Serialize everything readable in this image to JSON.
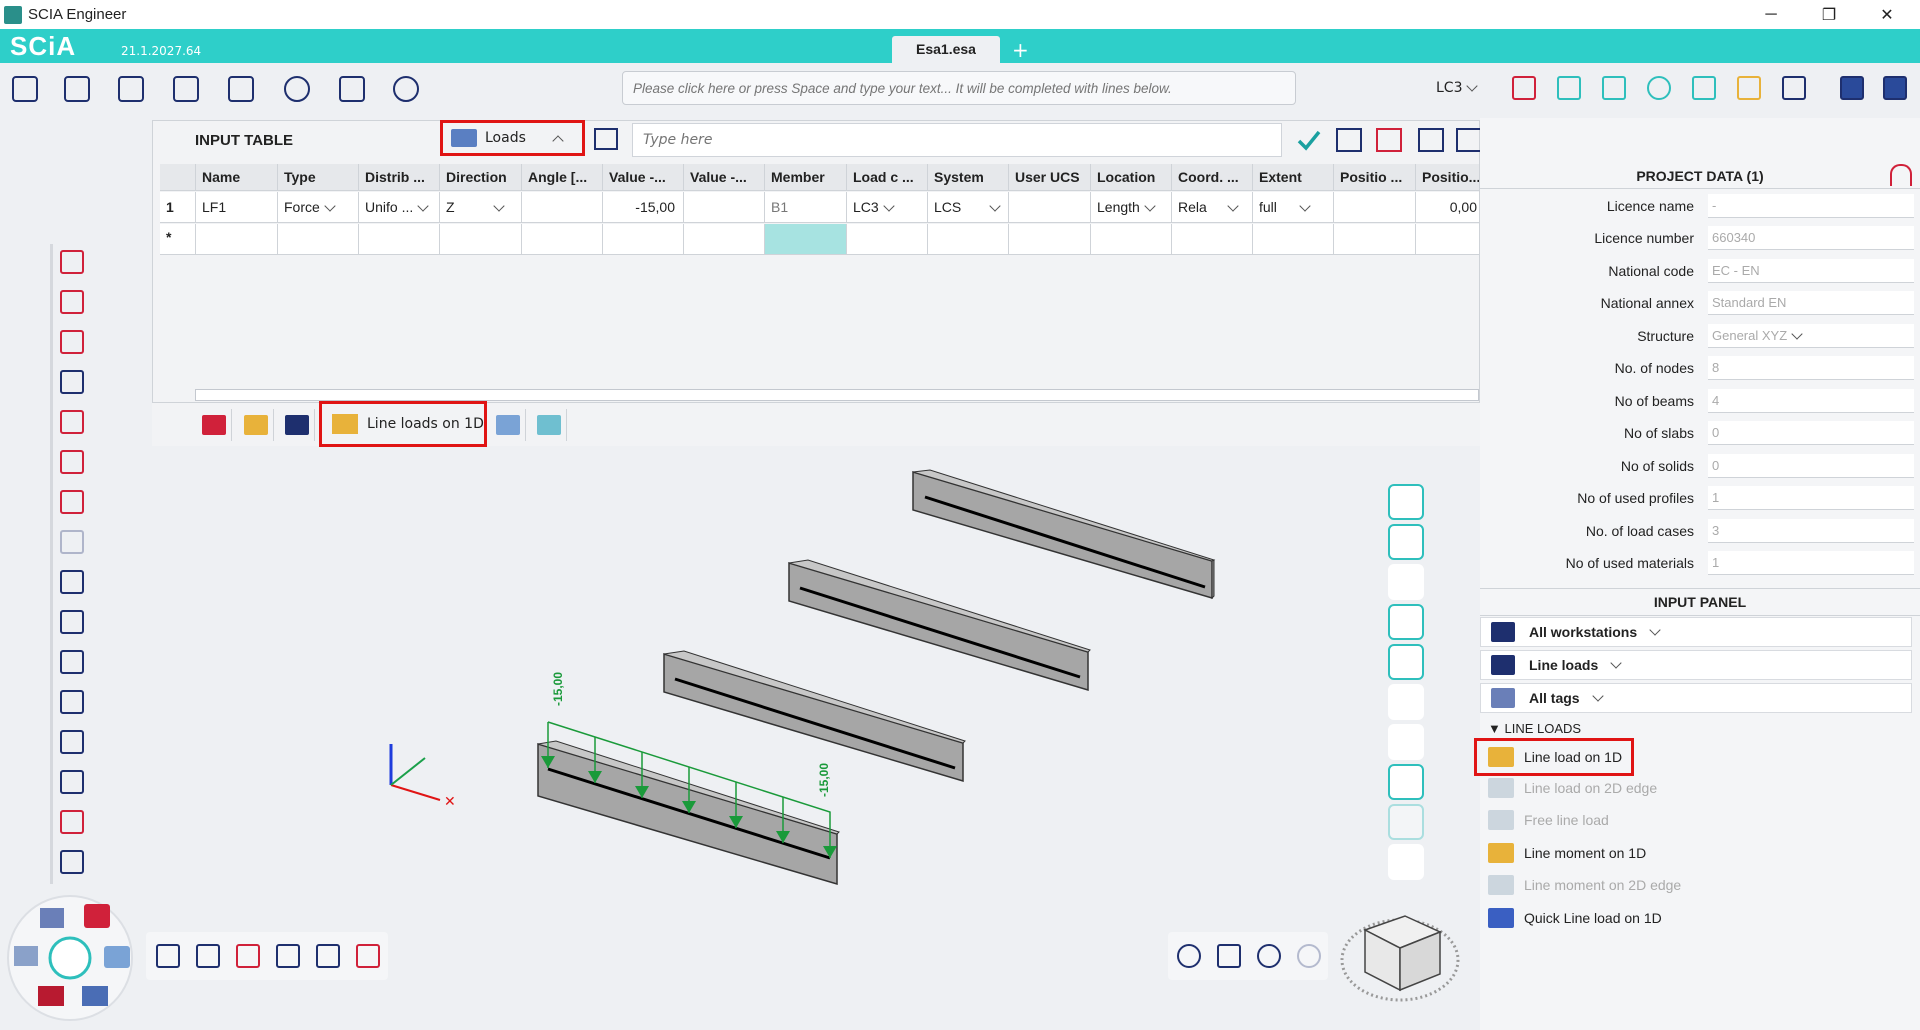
{
  "window": {
    "title": "SCIA Engineer",
    "minimize": "─",
    "restore": "❐",
    "close": "✕"
  },
  "brand": {
    "name": "SCiA",
    "version": "21.1.2027.64"
  },
  "tabs": {
    "document": "Esa1.esa",
    "add": "+"
  },
  "command_line": {
    "placeholder": "Please click here or press Space and type your text... It will be completed with lines below."
  },
  "load_case_selector": {
    "value": "LC3"
  },
  "input_table": {
    "title": "INPUT TABLE",
    "entity_dropdown": "Loads",
    "search_placeholder": "Type here",
    "columns": [
      "Name",
      "Type",
      "Distrib ...",
      "Direction",
      "Angle [...",
      "Value -...",
      "Value -...",
      "Member",
      "Load c ...",
      "System",
      "User UCS",
      "Location",
      "Coord. ...",
      "Extent",
      "Positio ...",
      "Positio..."
    ],
    "rows": [
      {
        "index": "1",
        "cells": [
          "LF1",
          "Force",
          "Unifo ...",
          "Z",
          "",
          "-15,00",
          "",
          "B1",
          "LC3",
          "LCS",
          "",
          "Length",
          "Rela",
          "full",
          "",
          "0,00"
        ]
      },
      {
        "index": "*",
        "cells": [
          "",
          "",
          "",
          "",
          "",
          "",
          "",
          "",
          "",
          "",
          "",
          "",
          "",
          "",
          "",
          ""
        ]
      }
    ]
  },
  "load_tabs": {
    "active_label": "Line loads on 1D"
  },
  "viewport": {
    "load_label_1": "-15,00",
    "load_label_2": "-15,00"
  },
  "project_data": {
    "title": "PROJECT DATA (1)",
    "fields": [
      {
        "label": "Licence name",
        "value": "-"
      },
      {
        "label": "Licence number",
        "value": "660340"
      },
      {
        "label": "National code",
        "value": "EC - EN"
      },
      {
        "label": "National annex",
        "value": "Standard EN"
      },
      {
        "label": "Structure",
        "value": "General XYZ"
      },
      {
        "label": "No. of nodes",
        "value": "8"
      },
      {
        "label": "No of beams",
        "value": "4"
      },
      {
        "label": "No of slabs",
        "value": "0"
      },
      {
        "label": "No of solids",
        "value": "0"
      },
      {
        "label": "No of used profiles",
        "value": "1"
      },
      {
        "label": "No. of load cases",
        "value": "3"
      },
      {
        "label": "No of used materials",
        "value": "1"
      }
    ]
  },
  "input_panel": {
    "title": "INPUT PANEL",
    "workstations": "All workstations",
    "category": "Line loads",
    "tags": "All tags",
    "group_header": "LINE LOADS",
    "items": [
      {
        "label": "Line load on 1D",
        "enabled": true
      },
      {
        "label": "Line load on 2D edge",
        "enabled": false
      },
      {
        "label": "Free line load",
        "enabled": false
      },
      {
        "label": "Line moment on 1D",
        "enabled": true
      },
      {
        "label": "Line moment on 2D edge",
        "enabled": false
      },
      {
        "label": "Quick Line load on 1D",
        "enabled": true
      }
    ]
  },
  "colors": {
    "accent": "#2ecfc9",
    "highlight": "#e01414",
    "icon": "#1e2f6e",
    "load": "#1a9a3a"
  }
}
